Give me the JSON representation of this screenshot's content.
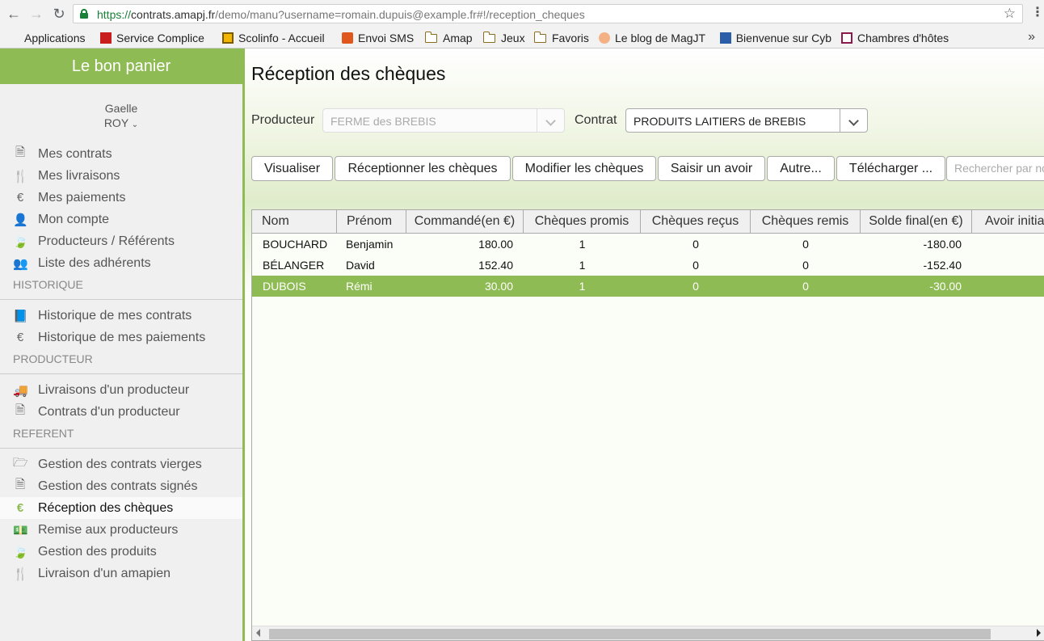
{
  "browser": {
    "url_scheme": "https://",
    "url_host": "contrats.amapj.fr",
    "url_rest": "/demo/manu?username=romain.dupuis@example.fr#!/reception_cheques",
    "bookmarks": [
      {
        "label": "Applications",
        "icon": "apps-grid-icon"
      },
      {
        "label": "Service Complice",
        "icon": "service-icon"
      },
      {
        "label": "Scolinfo - Accueil",
        "icon": "scolinfo-icon"
      },
      {
        "label": "Envoi SMS",
        "icon": "sms-icon"
      },
      {
        "label": "Amap",
        "icon": "folder-icon"
      },
      {
        "label": "Jeux",
        "icon": "folder-icon"
      },
      {
        "label": "Favoris",
        "icon": "folder-icon"
      },
      {
        "label": "Le blog de MagJT",
        "icon": "blog-icon"
      },
      {
        "label": "Bienvenue sur Cyb",
        "icon": "cyb-icon"
      },
      {
        "label": "Chambres d'hôtes",
        "icon": "house-icon"
      }
    ],
    "more": "»"
  },
  "sidebar": {
    "title": "Le bon panier",
    "user_first": "Gaelle",
    "user_last": "ROY",
    "main_items": [
      {
        "label": "Mes contrats",
        "icon": "document-icon",
        "glyph": "🗎"
      },
      {
        "label": "Mes livraisons",
        "icon": "cutlery-icon",
        "glyph": "🍴"
      },
      {
        "label": "Mes paiements",
        "icon": "euro-icon",
        "glyph": "€"
      },
      {
        "label": "Mon compte",
        "icon": "user-icon",
        "glyph": "👤"
      },
      {
        "label": "Producteurs / Référents",
        "icon": "leaf-icon",
        "glyph": "🍃"
      },
      {
        "label": "Liste des adhérents",
        "icon": "users-icon",
        "glyph": "👥"
      }
    ],
    "section_historique": "HISTORIQUE",
    "historique_items": [
      {
        "label": "Historique de mes contrats",
        "icon": "book-icon",
        "glyph": "📘"
      },
      {
        "label": "Historique de mes paiements",
        "icon": "euro-icon",
        "glyph": "€"
      }
    ],
    "section_producteur": "PRODUCTEUR",
    "producteur_items": [
      {
        "label": "Livraisons d'un producteur",
        "icon": "truck-icon",
        "glyph": "🚚"
      },
      {
        "label": "Contrats d'un producteur",
        "icon": "document-icon",
        "glyph": "🗎"
      }
    ],
    "section_referent": "REFERENT",
    "referent_items": [
      {
        "label": "Gestion des contrats vierges",
        "icon": "folder-open-icon",
        "glyph": "🗁"
      },
      {
        "label": "Gestion des contrats signés",
        "icon": "document-icon",
        "glyph": "🗎"
      },
      {
        "label": "Réception des chèques",
        "icon": "euro-icon",
        "glyph": "€",
        "active": true
      },
      {
        "label": "Remise aux producteurs",
        "icon": "money-icon",
        "glyph": "💵"
      },
      {
        "label": "Gestion des produits",
        "icon": "leaf-icon",
        "glyph": "🍃"
      },
      {
        "label": "Livraison d'un amapien",
        "icon": "cutlery-icon",
        "glyph": "🍴"
      }
    ]
  },
  "main": {
    "title": "Réception des chèques",
    "producteur_label": "Producteur",
    "producteur_value": "FERME des BREBIS",
    "contrat_label": "Contrat",
    "contrat_value": "PRODUITS LAITIERS de BREBIS",
    "buttons": {
      "visualiser": "Visualiser",
      "receptionner": "Réceptionner les chèques",
      "modifier": "Modifier les chèques",
      "avoir": "Saisir un avoir",
      "autre": "Autre...",
      "telecharger": "Télécharger ..."
    },
    "search_placeholder": "Rechercher par nom",
    "table": {
      "headers": [
        "Nom",
        "Prénom",
        "Commandé(en €)",
        "Chèques promis",
        "Chèques reçus",
        "Chèques remis",
        "Solde final(en €)",
        "Avoir initial"
      ],
      "rows": [
        {
          "nom": "BOUCHARD",
          "prenom": "Benjamin",
          "commande": "180.00",
          "promis": "1",
          "recus": "0",
          "remis": "0",
          "solde": "-180.00",
          "avoir": ""
        },
        {
          "nom": "BÉLANGER",
          "prenom": "David",
          "commande": "152.40",
          "promis": "1",
          "recus": "0",
          "remis": "0",
          "solde": "-152.40",
          "avoir": ""
        },
        {
          "nom": "DUBOIS",
          "prenom": "Rémi",
          "commande": "30.00",
          "promis": "1",
          "recus": "0",
          "remis": "0",
          "solde": "-30.00",
          "avoir": "",
          "selected": true
        }
      ]
    }
  },
  "colors": {
    "accent": "#8fbb54",
    "sidebar_bg": "#f0f0f0"
  }
}
